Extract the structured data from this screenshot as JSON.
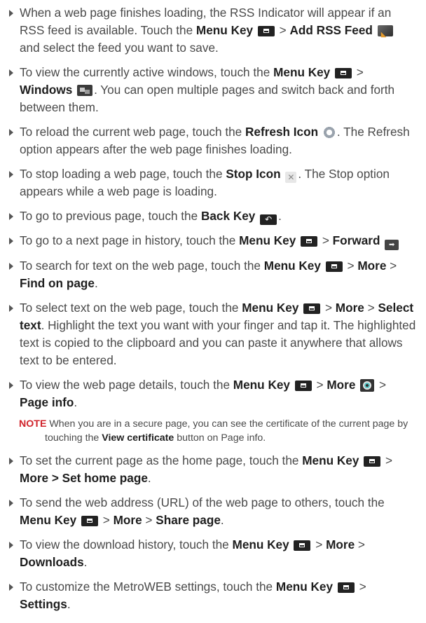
{
  "items": [
    {
      "s0": "When a web page finishes loading, the RSS Indicator will appear if an RSS feed is available. Touch the ",
      "b0": "Menu Key",
      "s1": " > ",
      "b1": "Add RSS Feed",
      "s2": " and select the feed you want to save."
    },
    {
      "s0": "To view the currently active windows, touch the ",
      "b0": "Menu Key",
      "s1": " > ",
      "b1": "Windows",
      "s2": ". You can open multiple pages and switch back and forth between them."
    },
    {
      "s0": "To reload the current web page, touch the ",
      "b0": "Refresh Icon",
      "s1": ". The Refresh option appears after the web page finishes loading."
    },
    {
      "s0": "To stop loading a web page, touch the ",
      "b0": "Stop Icon",
      "s1": ". The Stop option appears while a web page is loading."
    },
    {
      "s0": "To go to previous page, touch the ",
      "b0": "Back Key",
      "s1": "."
    },
    {
      "s0": "To go to a next page in history, touch the ",
      "b0": "Menu Key",
      "s1": " > ",
      "b1": "Forward"
    },
    {
      "s0": "To search for text on the web page, touch the ",
      "b0": "Menu Key",
      "s1": " > ",
      "b1": "More",
      "s2": " > ",
      "b2": "Find on page",
      "s3": "."
    },
    {
      "s0": "To select text on the web page, touch the ",
      "b0": "Menu Key",
      "s1": " > ",
      "b1": "More",
      "s2": " > ",
      "b2": "Select text",
      "s3": ". Highlight the text you want with your finger and tap it. The highlighted text is copied to the clipboard and you can paste it anywhere that allows text to be entered."
    },
    {
      "s0": "To view the web page details, touch the ",
      "b0": "Menu Key",
      "s1": " > ",
      "b1": "More",
      "s2": " > ",
      "b2": "Page info",
      "s3": "."
    },
    {
      "s0": "To set the current page as the home page, touch the ",
      "b0": "Menu Key",
      "s1": " > ",
      "b1": "More > Set home page",
      "s2": "."
    },
    {
      "s0": "To send the web address (URL) of the web page to others, touch the ",
      "b0": "Menu Key",
      "s1": " > ",
      "b1": "More",
      "s2": " > ",
      "b2": "Share page",
      "s3": "."
    },
    {
      "s0": "To view the download history, touch the ",
      "b0": "Menu Key",
      "s1": " > ",
      "b1": "More",
      "s2": " > ",
      "b2": "Downloads",
      "s3": "."
    },
    {
      "s0": "To customize the MetroWEB settings, touch the ",
      "b0": "Menu Key",
      "s1": " > ",
      "b1": "Settings",
      "s2": "."
    }
  ],
  "note": {
    "label": "NOTE",
    "t0": " When you are in a secure page, you can see the certificate of the current page by touching the ",
    "b0": "View certificate",
    "t1": " button on Page info."
  },
  "colors": {
    "body_text": "#4a4a4a",
    "emphasis_text": "#1e1e1e",
    "note_label": "#d0232b"
  },
  "icons": [
    "menu-key-icon",
    "rss-feed-icon",
    "windows-icon",
    "refresh-icon",
    "stop-icon",
    "back-key-icon",
    "forward-icon",
    "more-icon"
  ]
}
